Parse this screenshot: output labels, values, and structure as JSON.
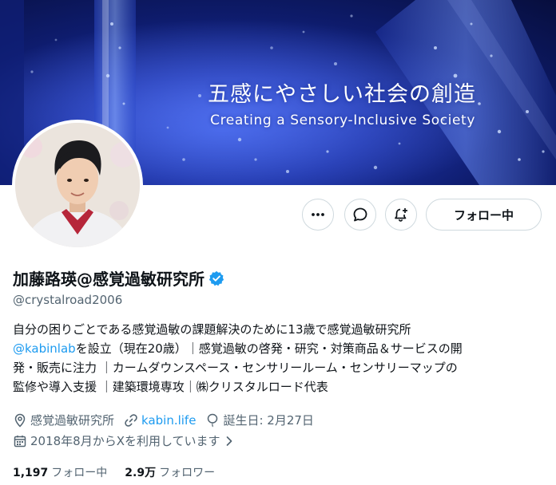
{
  "banner": {
    "title": "五感にやさしい社会の創造",
    "subtitle": "Creating a Sensory-Inclusive Society"
  },
  "actions": {
    "more_icon": "more-horizontal-icon",
    "message_icon": "message-icon",
    "notify_icon": "notification-bell-icon",
    "follow_label": "フォロー中"
  },
  "profile": {
    "display_name": "加藤路瑛@感覚過敏研究所",
    "handle": "@crystalroad2006",
    "bio": {
      "line1": "自分の困りごとである感覚過敏の課題解決のために13歳で感覚過敏研究所",
      "mention": "@kabinlab",
      "line2_rest": "を設立（現在20歳）｜感覚過敏の啓発・研究・対策商品＆サービスの開",
      "line3": "発・販売に注力 ｜カームダウンスペース・センサリールーム・センサリーマップの",
      "line4": "監修や導入支援 ｜建築環境専攻｜㈱クリスタルロード代表"
    },
    "location": "感覚過敏研究所",
    "website": "kabin.life",
    "birthday": "誕生日: 2月27日",
    "joined": "2018年8月からXを利用しています"
  },
  "stats": {
    "following_count": "1,197",
    "following_label": "フォロー中",
    "followers_count": "2.9万",
    "followers_label": "フォロワー"
  },
  "colors": {
    "accent": "#1d9bf0",
    "text_primary": "#0f1419",
    "text_secondary": "#536471",
    "border": "#cfd9de"
  }
}
